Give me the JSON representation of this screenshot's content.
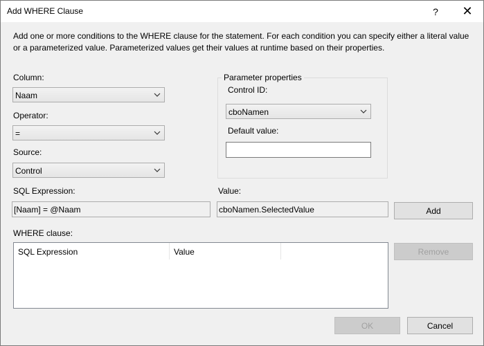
{
  "window": {
    "title": "Add WHERE Clause",
    "help_glyph": "?",
    "close_glyph": "✕"
  },
  "description": "Add one or more conditions to the WHERE clause for the statement. For each condition you can specify either a literal value or a parameterized value. Parameterized values get their values at runtime based on their properties.",
  "column": {
    "label": "Column:",
    "value": "Naam"
  },
  "operator": {
    "label": "Operator:",
    "value": "="
  },
  "source": {
    "label": "Source:",
    "value": "Control"
  },
  "parameter_properties": {
    "legend": "Parameter properties",
    "control_id_label": "Control ID:",
    "control_id_value": "cboNamen",
    "default_value_label": "Default value:",
    "default_value": ""
  },
  "sql_expression": {
    "label": "SQL Expression:",
    "value": "[Naam] = @Naam"
  },
  "value": {
    "label": "Value:",
    "value": "cboNamen.SelectedValue"
  },
  "buttons": {
    "add": "Add",
    "remove": "Remove",
    "ok": "OK",
    "cancel": "Cancel"
  },
  "where_clause": {
    "label": "WHERE clause:",
    "columns": [
      "SQL Expression",
      "Value"
    ]
  },
  "icons": {
    "dropdown": "chevron-down-icon",
    "help": "help-icon",
    "close": "close-icon"
  }
}
